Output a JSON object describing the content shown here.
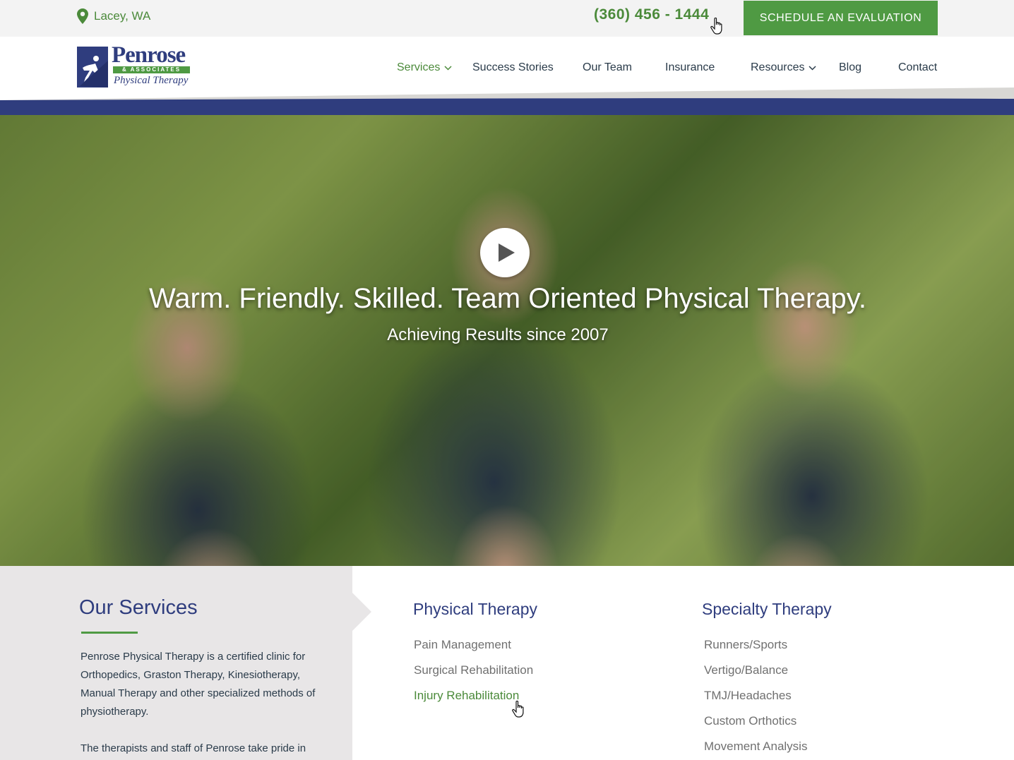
{
  "topbar": {
    "location": "Lacey, WA",
    "phone": "(360) 456 - 1444",
    "schedule_label": "SCHEDULE AN EVALUATION"
  },
  "logo": {
    "name": "Penrose",
    "associates": "& ASSOCIATES",
    "tagline": "Physical Therapy"
  },
  "nav": {
    "items": [
      {
        "label": "Services",
        "dropdown": true,
        "active": true
      },
      {
        "label": "Success Stories"
      },
      {
        "label": "Our Team"
      },
      {
        "label": "Insurance"
      },
      {
        "label": "Resources",
        "dropdown": true
      },
      {
        "label": "Blog"
      },
      {
        "label": "Contact"
      }
    ]
  },
  "hero": {
    "title": "Warm. Friendly. Skilled. Team Oriented Physical Therapy.",
    "subtitle": "Achieving Results since 2007"
  },
  "services": {
    "title": "Our Services",
    "paragraph1": "Penrose Physical Therapy is a certified clinic for Orthopedics, Graston Therapy, Kinesiotherapy, Manual Therapy and other specialized methods of physiotherapy.",
    "paragraph2": "The therapists and staff of Penrose take pride in",
    "physical": {
      "title": "Physical Therapy",
      "items": [
        "Pain Management",
        "Surgical Rehabilitation",
        "Injury Rehabilitation"
      ]
    },
    "specialty": {
      "title": "Specialty Therapy",
      "items": [
        "Runners/Sports",
        "Vertigo/Balance",
        "TMJ/Headaches",
        "Custom Orthotics",
        "Movement Analysis"
      ]
    }
  },
  "colors": {
    "brand_blue": "#2f3d7e",
    "brand_green": "#4f9a43",
    "link_green": "#4b8a3a",
    "panel_gray": "#e8e6e7"
  },
  "icons": [
    "map-pin-icon",
    "chevron-down-icon",
    "play-icon",
    "hand-cursor-icon"
  ]
}
